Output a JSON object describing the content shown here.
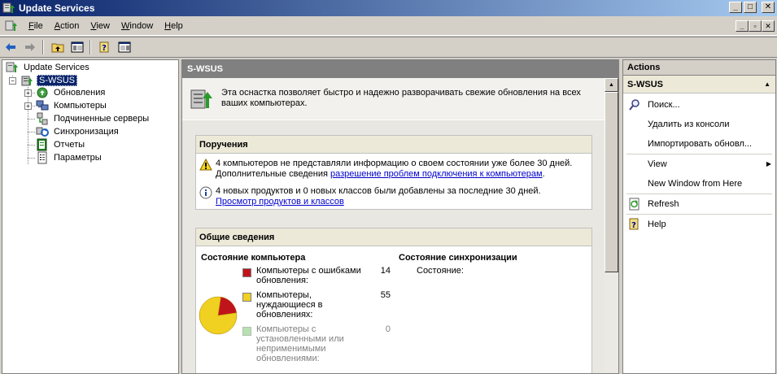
{
  "window": {
    "title": "Update Services",
    "buttons": {
      "minimize": "_",
      "maximize": "□",
      "close": "✕"
    }
  },
  "menu": {
    "items": [
      {
        "label": "File",
        "u": "F",
        "rest": "ile"
      },
      {
        "label": "Action",
        "u": "A",
        "rest": "ction"
      },
      {
        "label": "View",
        "u": "V",
        "rest": "iew"
      },
      {
        "label": "Window",
        "u": "W",
        "rest": "indow"
      },
      {
        "label": "Help",
        "u": "H",
        "rest": "elp"
      }
    ],
    "inner_buttons": {
      "minimize": "_",
      "restore": "▫",
      "close": "✕"
    }
  },
  "toolbar": {
    "icons": [
      "back-arrow-icon",
      "forward-arrow-icon",
      "up-folder-icon",
      "show-hide-tree-icon",
      "help-icon",
      "show-hide-action-pane-icon"
    ]
  },
  "tree": {
    "root": "Update Services",
    "server": "S-WSUS",
    "children": [
      {
        "label": "Обновления",
        "expandable": true
      },
      {
        "label": "Компьютеры",
        "expandable": true
      },
      {
        "label": "Подчиненные серверы",
        "expandable": false
      },
      {
        "label": "Синхронизация",
        "expandable": false
      },
      {
        "label": "Отчеты",
        "expandable": false
      },
      {
        "label": "Параметры",
        "expandable": false
      }
    ]
  },
  "main": {
    "header": "S-WSUS",
    "intro": {
      "line1": "Эта оснастка позволяет быстро и надежно разворачивать свежие обновления на всех",
      "line2": "ваших компьютерах."
    },
    "tasks": {
      "title": "Поручения",
      "alert1_line1": "4 компьютеров не представляли информацию о своем состоянии уже более 30 дней.",
      "alert1_line2_prefix": "Дополнительные сведения ",
      "alert1_link": "разрешение проблем подключения к компьютерам",
      "alert1_suffix": ".",
      "alert2_line1": "4 новых продуктов и 0 новых классов были добавлены за последние 30 дней.",
      "alert2_link": "Просмотр продуктов и классов"
    },
    "overview": {
      "title": "Общие сведения",
      "computer_status_title": "Состояние компьютера",
      "sync_status_title": "Состояние синхронизации",
      "sync_state_label": "Состояние:",
      "legend": [
        {
          "label": "Компьютеры с ошибками обновления:",
          "value": "14",
          "color": "#c0141c"
        },
        {
          "label": "Компьютеры, нуждающиеся в обновлениях:",
          "value": "55",
          "color": "#f0d020"
        },
        {
          "label": "Компьютеры с установленными или неприменимыми обновлениями:",
          "value": "0",
          "color": "#b8e0b0"
        }
      ]
    }
  },
  "actions": {
    "header": "Actions",
    "group": "S-WSUS",
    "items": [
      {
        "label": "Поиск...",
        "icon": "search-icon"
      },
      {
        "label": "Удалить из консоли",
        "icon": ""
      },
      {
        "label": "Импортировать обновл...",
        "icon": ""
      },
      {
        "label": "View",
        "icon": "",
        "submenu": true
      },
      {
        "label": "New Window from Here",
        "icon": ""
      },
      {
        "label": "Refresh",
        "icon": "refresh-icon"
      },
      {
        "label": "Help",
        "icon": "help-icon"
      }
    ]
  }
}
